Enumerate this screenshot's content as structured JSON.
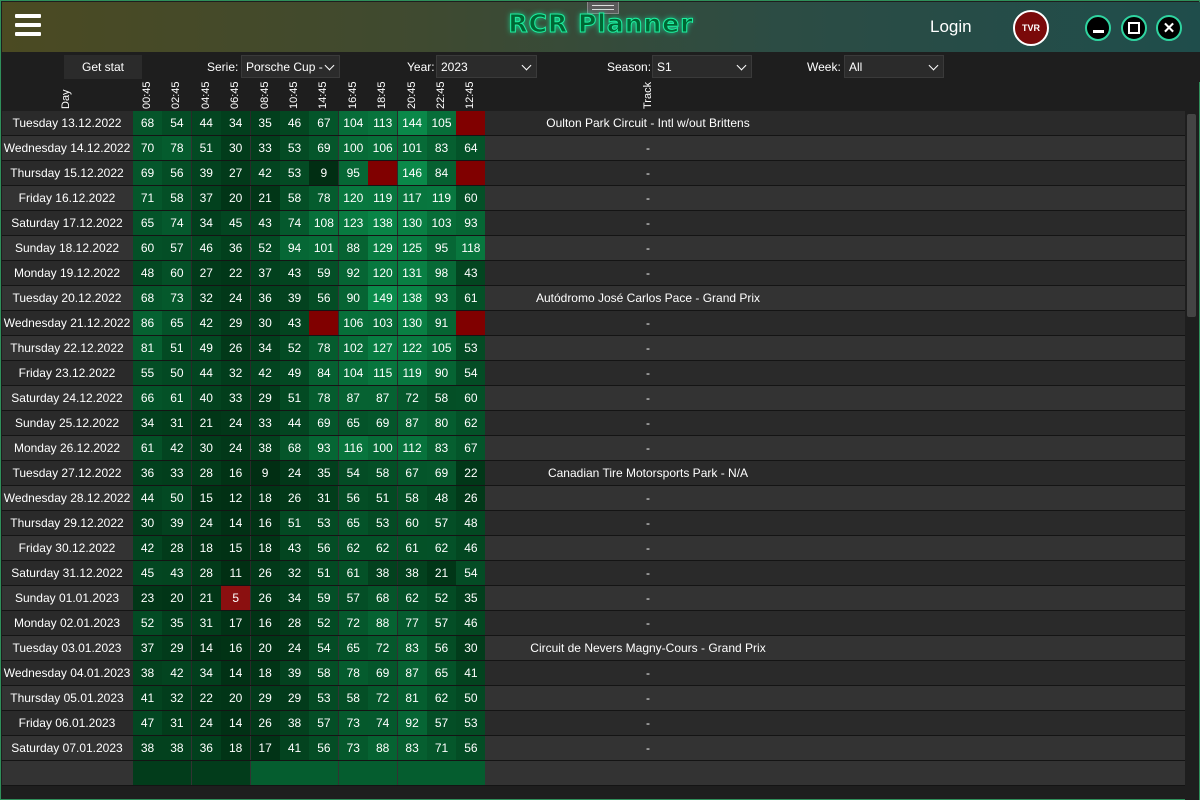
{
  "app": {
    "title": "RCR Planner",
    "login_label": "Login",
    "avatar_text": "TVR",
    "window_controls": [
      "minimize-icon",
      "maximize-icon",
      "close-icon"
    ]
  },
  "toolbar": {
    "get_stat_label": "Get stat",
    "serie_label": "Serie:",
    "serie_value": "Porsche Cup -",
    "year_label": "Year:",
    "year_value": "2023",
    "season_label": "Season:",
    "season_value": "S1",
    "week_label": "Week:",
    "week_value": "All"
  },
  "colors": {
    "accent": "#1cf0a0",
    "empty_cell": "#800000",
    "low_cell": "#8b1010"
  },
  "table": {
    "day_header": "Day",
    "track_header": "Track",
    "time_headers": [
      "00:45",
      "02:45",
      "04:45",
      "06:45",
      "08:45",
      "10:45",
      "14:45",
      "16:45",
      "18:45",
      "20:45",
      "22:45",
      "12:45"
    ],
    "rows": [
      {
        "day": "Tuesday 13.12.2022",
        "values": [
          68,
          54,
          44,
          34,
          35,
          46,
          67,
          104,
          113,
          144,
          105,
          null
        ],
        "track": "Oulton Park Circuit - Intl w/out Brittens"
      },
      {
        "day": "Wednesday 14.12.2022",
        "values": [
          70,
          78,
          51,
          30,
          33,
          53,
          69,
          100,
          106,
          101,
          83,
          64
        ],
        "track": "-"
      },
      {
        "day": "Thursday 15.12.2022",
        "values": [
          69,
          56,
          39,
          27,
          42,
          53,
          9,
          95,
          null,
          146,
          84,
          null
        ],
        "track": "-"
      },
      {
        "day": "Friday 16.12.2022",
        "values": [
          71,
          58,
          37,
          20,
          21,
          58,
          78,
          120,
          119,
          117,
          119,
          60
        ],
        "track": "-"
      },
      {
        "day": "Saturday 17.12.2022",
        "values": [
          65,
          74,
          34,
          45,
          43,
          74,
          108,
          123,
          138,
          130,
          103,
          93
        ],
        "track": "-"
      },
      {
        "day": "Sunday 18.12.2022",
        "values": [
          60,
          57,
          46,
          36,
          52,
          94,
          101,
          88,
          129,
          125,
          95,
          118
        ],
        "track": "-"
      },
      {
        "day": "Monday 19.12.2022",
        "values": [
          48,
          60,
          27,
          22,
          37,
          43,
          59,
          92,
          120,
          131,
          98,
          43
        ],
        "track": "-"
      },
      {
        "day": "Tuesday 20.12.2022",
        "values": [
          68,
          73,
          32,
          24,
          36,
          39,
          56,
          90,
          149,
          138,
          93,
          61
        ],
        "track": "Autódromo José Carlos Pace - Grand Prix"
      },
      {
        "day": "Wednesday 21.12.2022",
        "values": [
          86,
          65,
          42,
          29,
          30,
          43,
          null,
          106,
          103,
          130,
          91,
          null
        ],
        "track": "-"
      },
      {
        "day": "Thursday 22.12.2022",
        "values": [
          81,
          51,
          49,
          26,
          34,
          52,
          78,
          102,
          127,
          122,
          105,
          53
        ],
        "track": "-"
      },
      {
        "day": "Friday 23.12.2022",
        "values": [
          55,
          50,
          44,
          32,
          42,
          49,
          84,
          104,
          115,
          119,
          90,
          54
        ],
        "track": "-"
      },
      {
        "day": "Saturday 24.12.2022",
        "values": [
          66,
          61,
          40,
          33,
          29,
          51,
          78,
          87,
          87,
          72,
          58,
          60
        ],
        "track": "-"
      },
      {
        "day": "Sunday 25.12.2022",
        "values": [
          34,
          31,
          21,
          24,
          33,
          44,
          69,
          65,
          69,
          87,
          80,
          62
        ],
        "track": "-"
      },
      {
        "day": "Monday 26.12.2022",
        "values": [
          61,
          42,
          30,
          24,
          38,
          68,
          93,
          116,
          100,
          112,
          83,
          67
        ],
        "track": "-"
      },
      {
        "day": "Tuesday 27.12.2022",
        "values": [
          36,
          33,
          28,
          16,
          9,
          24,
          35,
          54,
          58,
          67,
          69,
          22
        ],
        "track": "Canadian Tire Motorsports Park - N/A"
      },
      {
        "day": "Wednesday 28.12.2022",
        "values": [
          44,
          50,
          15,
          12,
          18,
          26,
          31,
          56,
          51,
          58,
          48,
          26
        ],
        "track": "-"
      },
      {
        "day": "Thursday 29.12.2022",
        "values": [
          30,
          39,
          24,
          14,
          16,
          51,
          53,
          65,
          53,
          60,
          57,
          48
        ],
        "track": "-"
      },
      {
        "day": "Friday 30.12.2022",
        "values": [
          42,
          28,
          18,
          15,
          18,
          43,
          56,
          62,
          62,
          61,
          62,
          46
        ],
        "track": "-"
      },
      {
        "day": "Saturday 31.12.2022",
        "values": [
          45,
          43,
          28,
          11,
          26,
          32,
          51,
          61,
          38,
          38,
          21,
          54
        ],
        "track": "-"
      },
      {
        "day": "Sunday 01.01.2023",
        "values": [
          23,
          20,
          21,
          5,
          26,
          34,
          59,
          57,
          68,
          62,
          52,
          35
        ],
        "track": "-"
      },
      {
        "day": "Monday 02.01.2023",
        "values": [
          52,
          35,
          31,
          17,
          16,
          28,
          52,
          72,
          88,
          77,
          57,
          46
        ],
        "track": "-"
      },
      {
        "day": "Tuesday 03.01.2023",
        "values": [
          37,
          29,
          14,
          16,
          20,
          24,
          54,
          65,
          72,
          83,
          56,
          30
        ],
        "track": "Circuit de Nevers Magny-Cours - Grand Prix"
      },
      {
        "day": "Wednesday 04.01.2023",
        "values": [
          38,
          42,
          34,
          14,
          18,
          39,
          58,
          78,
          69,
          87,
          65,
          41
        ],
        "track": "-"
      },
      {
        "day": "Thursday 05.01.2023",
        "values": [
          41,
          32,
          22,
          20,
          29,
          29,
          53,
          58,
          72,
          81,
          62,
          50
        ],
        "track": "-"
      },
      {
        "day": "Friday 06.01.2023",
        "values": [
          47,
          31,
          24,
          14,
          26,
          38,
          57,
          73,
          74,
          92,
          57,
          53
        ],
        "track": "-"
      },
      {
        "day": "Saturday 07.01.2023",
        "values": [
          38,
          38,
          36,
          18,
          17,
          41,
          56,
          73,
          88,
          83,
          71,
          56
        ],
        "track": "-"
      }
    ]
  }
}
